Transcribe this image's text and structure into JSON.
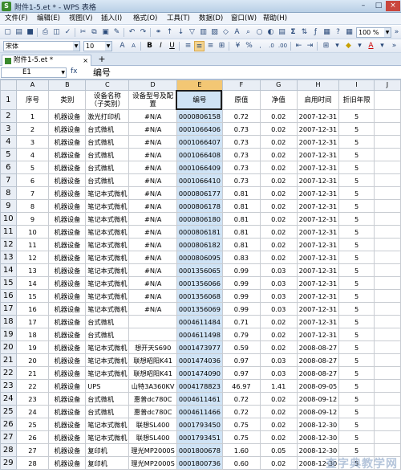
{
  "window": {
    "title": "附件1-5.et * - WPS 表格",
    "logo": "S",
    "minimize": "–",
    "maximize": "□",
    "close": "×"
  },
  "menu": [
    "文件(F)",
    "编辑(E)",
    "视图(V)",
    "插入(I)",
    "格式(O)",
    "工具(T)",
    "数据(D)",
    "窗口(W)",
    "帮助(H)"
  ],
  "toolbar": {
    "font": "宋体",
    "size": "10",
    "zoom": "100 %",
    "bold": "B",
    "italic": "I",
    "underline": "U"
  },
  "tab": {
    "label": "附件1-5.et *",
    "close": "×",
    "new": "+"
  },
  "formula": {
    "cell": "E1",
    "fx": "fx",
    "content": "编号"
  },
  "columns": [
    "A",
    "B",
    "C",
    "D",
    "E",
    "F",
    "G",
    "H",
    "I",
    "J"
  ],
  "header": {
    "row": "1",
    "cells": [
      "序号",
      "类别",
      "设备名称（子类别）",
      "设备型号及配置",
      "编号",
      "原值",
      "净值",
      "启用时间",
      "折旧年限",
      ""
    ]
  },
  "rows": [
    [
      "2",
      "1",
      "机器设备",
      "激光打印机",
      "#N/A",
      "0000806158",
      "0.72",
      "0.02",
      "2007-12-31",
      "5"
    ],
    [
      "3",
      "2",
      "机器设备",
      "台式微机",
      "#N/A",
      "0001066406",
      "0.73",
      "0.02",
      "2007-12-31",
      "5"
    ],
    [
      "4",
      "3",
      "机器设备",
      "台式微机",
      "#N/A",
      "0001066407",
      "0.73",
      "0.02",
      "2007-12-31",
      "5"
    ],
    [
      "5",
      "4",
      "机器设备",
      "台式微机",
      "#N/A",
      "0001066408",
      "0.73",
      "0.02",
      "2007-12-31",
      "5"
    ],
    [
      "6",
      "5",
      "机器设备",
      "台式微机",
      "#N/A",
      "0001066409",
      "0.73",
      "0.02",
      "2007-12-31",
      "5"
    ],
    [
      "7",
      "6",
      "机器设备",
      "台式微机",
      "#N/A",
      "0001066410",
      "0.73",
      "0.02",
      "2007-12-31",
      "5"
    ],
    [
      "8",
      "7",
      "机器设备",
      "笔记本式微机",
      "#N/A",
      "0000806177",
      "0.81",
      "0.02",
      "2007-12-31",
      "5"
    ],
    [
      "9",
      "8",
      "机器设备",
      "笔记本式微机",
      "#N/A",
      "0000806178",
      "0.81",
      "0.02",
      "2007-12-31",
      "5"
    ],
    [
      "10",
      "9",
      "机器设备",
      "笔记本式微机",
      "#N/A",
      "0000806180",
      "0.81",
      "0.02",
      "2007-12-31",
      "5"
    ],
    [
      "11",
      "10",
      "机器设备",
      "笔记本式微机",
      "#N/A",
      "0000806181",
      "0.81",
      "0.02",
      "2007-12-31",
      "5"
    ],
    [
      "12",
      "11",
      "机器设备",
      "笔记本式微机",
      "#N/A",
      "0000806182",
      "0.81",
      "0.02",
      "2007-12-31",
      "5"
    ],
    [
      "13",
      "12",
      "机器设备",
      "笔记本式微机",
      "#N/A",
      "0000806095",
      "0.83",
      "0.02",
      "2007-12-31",
      "5"
    ],
    [
      "14",
      "13",
      "机器设备",
      "笔记本式微机",
      "#N/A",
      "0001356065",
      "0.99",
      "0.03",
      "2007-12-31",
      "5"
    ],
    [
      "15",
      "14",
      "机器设备",
      "笔记本式微机",
      "#N/A",
      "0001356066",
      "0.99",
      "0.03",
      "2007-12-31",
      "5"
    ],
    [
      "16",
      "15",
      "机器设备",
      "笔记本式微机",
      "#N/A",
      "0001356068",
      "0.99",
      "0.03",
      "2007-12-31",
      "5"
    ],
    [
      "17",
      "16",
      "机器设备",
      "笔记本式微机",
      "#N/A",
      "0001356069",
      "0.99",
      "0.03",
      "2007-12-31",
      "5"
    ],
    [
      "18",
      "17",
      "机器设备",
      "台式微机",
      "",
      "0004611484",
      "0.71",
      "0.02",
      "2007-12-31",
      "5"
    ],
    [
      "19",
      "18",
      "机器设备",
      "台式微机",
      "",
      "0004611498",
      "0.79",
      "0.02",
      "2007-12-31",
      "5"
    ],
    [
      "20",
      "19",
      "机器设备",
      "笔记本式微机",
      "想开天S690",
      "0001473977",
      "0.59",
      "0.02",
      "2008-08-27",
      "5"
    ],
    [
      "21",
      "20",
      "机器设备",
      "笔记本式微机",
      "联想昭阳K41",
      "0001474036",
      "0.97",
      "0.03",
      "2008-08-27",
      "5"
    ],
    [
      "22",
      "21",
      "机器设备",
      "笔记本式微机",
      "联想昭阳K41",
      "0001474090",
      "0.97",
      "0.03",
      "2008-08-27",
      "5"
    ],
    [
      "23",
      "22",
      "机器设备",
      "UPS",
      "山特3A360KV",
      "0004178823",
      "46.97",
      "1.41",
      "2008-09-05",
      "5"
    ],
    [
      "24",
      "23",
      "机器设备",
      "台式微机",
      "惠普dc780C",
      "0004611461",
      "0.72",
      "0.02",
      "2008-09-12",
      "5"
    ],
    [
      "25",
      "24",
      "机器设备",
      "台式微机",
      "惠普dc780C",
      "0004611466",
      "0.72",
      "0.02",
      "2008-09-12",
      "5"
    ],
    [
      "26",
      "25",
      "机器设备",
      "笔记本式微机",
      "联想SL400",
      "0001793450",
      "0.75",
      "0.02",
      "2008-12-30",
      "5"
    ],
    [
      "27",
      "26",
      "机器设备",
      "笔记本式微机",
      "联想SL400",
      "0001793451",
      "0.75",
      "0.02",
      "2008-12-30",
      "5"
    ],
    [
      "28",
      "27",
      "机器设备",
      "复印机",
      "理光MP2000S",
      "0001800678",
      "1.60",
      "0.05",
      "2008-12-30",
      "5"
    ],
    [
      "29",
      "28",
      "机器设备",
      "复印机",
      "理光MP2000S",
      "0001800736",
      "0.60",
      "0.02",
      "2008-12-30",
      "5"
    ]
  ],
  "watermark": "查字典教学网"
}
